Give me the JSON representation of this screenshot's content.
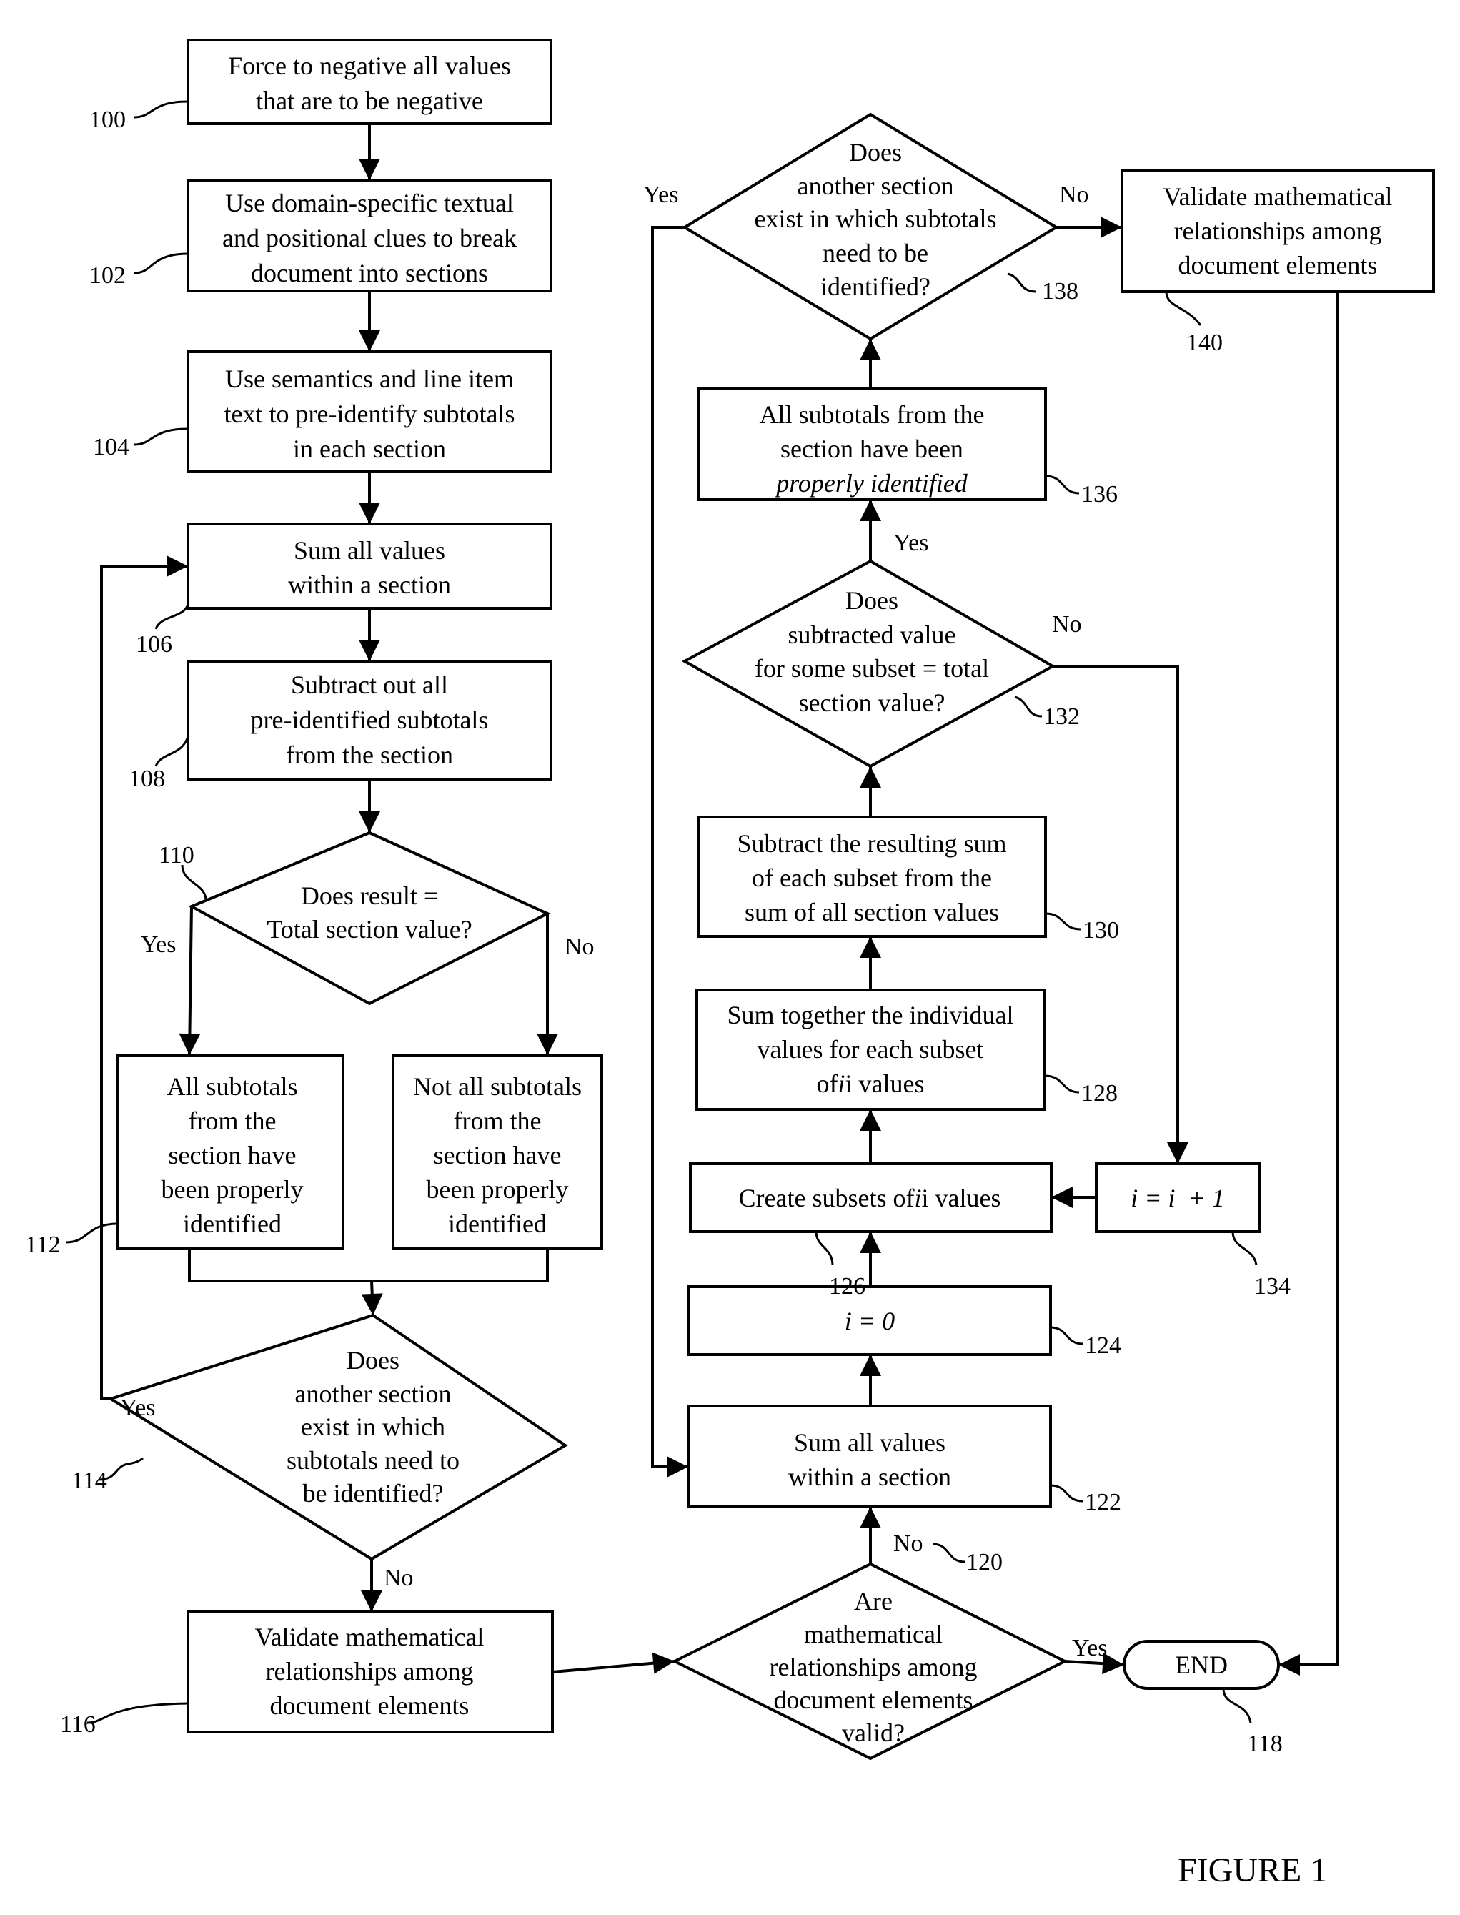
{
  "figure": {
    "title": "FIGURE 1"
  },
  "nodes": {
    "n100": {
      "ref": "100",
      "shape": "process",
      "lines": [
        "Force to negative all values",
        "that are to be negative"
      ]
    },
    "n102": {
      "ref": "102",
      "shape": "process",
      "lines": [
        "Use domain-specific textual",
        "and positional clues to break",
        "document into sections"
      ]
    },
    "n104": {
      "ref": "104",
      "shape": "process",
      "lines": [
        "Use semantics and line item",
        "text to pre-identify subtotals",
        "in each section"
      ]
    },
    "n106": {
      "ref": "106",
      "shape": "process",
      "lines": [
        "Sum all values",
        "within a section"
      ]
    },
    "n108": {
      "ref": "108",
      "shape": "process",
      "lines": [
        "Subtract out all",
        "pre-identified subtotals",
        "from the section"
      ]
    },
    "n110": {
      "ref": "110",
      "shape": "decision",
      "lines": [
        "Does result =",
        "Total section value?"
      ]
    },
    "n112": {
      "ref": "112",
      "shape": "process",
      "lines": [
        "All subtotals",
        "from the",
        "section have",
        "been properly",
        "identified"
      ]
    },
    "n112b": {
      "ref": "",
      "shape": "process",
      "lines": [
        "Not all subtotals",
        "from the",
        "section have",
        "been properly",
        "identified"
      ]
    },
    "n114": {
      "ref": "114",
      "shape": "decision",
      "lines": [
        "Does",
        "another section",
        "exist in which",
        "subtotals need to",
        "be identified?"
      ]
    },
    "n116": {
      "ref": "116",
      "shape": "process",
      "lines": [
        "Validate mathematical",
        "relationships among",
        "document elements"
      ]
    },
    "n120": {
      "ref": "120",
      "shape": "decision",
      "lines": [
        "Are",
        "mathematical",
        "relationships among",
        "document elements",
        "valid?"
      ]
    },
    "n118": {
      "ref": "118",
      "shape": "terminator",
      "lines": [
        "END"
      ]
    },
    "n122": {
      "ref": "122",
      "shape": "process",
      "lines": [
        "Sum all values",
        "within a section"
      ]
    },
    "n124": {
      "ref": "124",
      "shape": "process",
      "lines": [
        "i = 0"
      ]
    },
    "n126": {
      "ref": "126",
      "shape": "process",
      "lines": [
        "Create subsets of i values"
      ]
    },
    "n134": {
      "ref": "134",
      "shape": "process",
      "lines": [
        "i = i  + 1"
      ]
    },
    "n128": {
      "ref": "128",
      "shape": "process",
      "lines": [
        "Sum together the individual",
        "values for each subset",
        "of i values"
      ]
    },
    "n130": {
      "ref": "130",
      "shape": "process",
      "lines": [
        "Subtract the resulting sum",
        "of each subset from the",
        "sum of all section values"
      ]
    },
    "n132": {
      "ref": "132",
      "shape": "decision",
      "lines": [
        "Does",
        "subtracted value",
        "for some subset = total",
        "section value?"
      ]
    },
    "n136": {
      "ref": "136",
      "shape": "process",
      "lines": [
        "All subtotals from the",
        "section have been",
        "properly identified"
      ]
    },
    "n138": {
      "ref": "138",
      "shape": "decision",
      "lines": [
        "Does",
        "another section",
        "exist in which subtotals",
        "need to be",
        "identified?"
      ]
    },
    "n140": {
      "ref": "140",
      "shape": "process",
      "lines": [
        "Validate mathematical",
        "relationships among",
        "document elements"
      ]
    }
  },
  "branch_labels": {
    "b110_yes": "Yes",
    "b110_no": "No",
    "b114_yes": "Yes",
    "b114_no": "No",
    "b120_yes": "Yes",
    "b120_no": "No",
    "b132_yes": "Yes",
    "b132_no": "No",
    "b138_yes": "Yes",
    "b138_no": "No"
  },
  "edges": [
    {
      "from": "n100",
      "to": "n102"
    },
    {
      "from": "n102",
      "to": "n104"
    },
    {
      "from": "n104",
      "to": "n106"
    },
    {
      "from": "n106",
      "to": "n108"
    },
    {
      "from": "n108",
      "to": "n110"
    },
    {
      "from": "n110",
      "to": "n112",
      "label": "Yes"
    },
    {
      "from": "n110",
      "to": "n112b",
      "label": "No"
    },
    {
      "from": "n112",
      "to": "n114"
    },
    {
      "from": "n112b",
      "to": "n114"
    },
    {
      "from": "n114",
      "to": "n106",
      "label": "Yes"
    },
    {
      "from": "n114",
      "to": "n116",
      "label": "No"
    },
    {
      "from": "n116",
      "to": "n120"
    },
    {
      "from": "n120",
      "to": "n118",
      "label": "Yes"
    },
    {
      "from": "n120",
      "to": "n122",
      "label": "No"
    },
    {
      "from": "n122",
      "to": "n124"
    },
    {
      "from": "n124",
      "to": "n126"
    },
    {
      "from": "n126",
      "to": "n128"
    },
    {
      "from": "n128",
      "to": "n130"
    },
    {
      "from": "n130",
      "to": "n132"
    },
    {
      "from": "n132",
      "to": "n136",
      "label": "Yes"
    },
    {
      "from": "n132",
      "to": "n134",
      "label": "No"
    },
    {
      "from": "n134",
      "to": "n126"
    },
    {
      "from": "n136",
      "to": "n138"
    },
    {
      "from": "n138",
      "to": "n122",
      "label": "Yes"
    },
    {
      "from": "n138",
      "to": "n140",
      "label": "No"
    },
    {
      "from": "n140",
      "to": "n118"
    }
  ]
}
